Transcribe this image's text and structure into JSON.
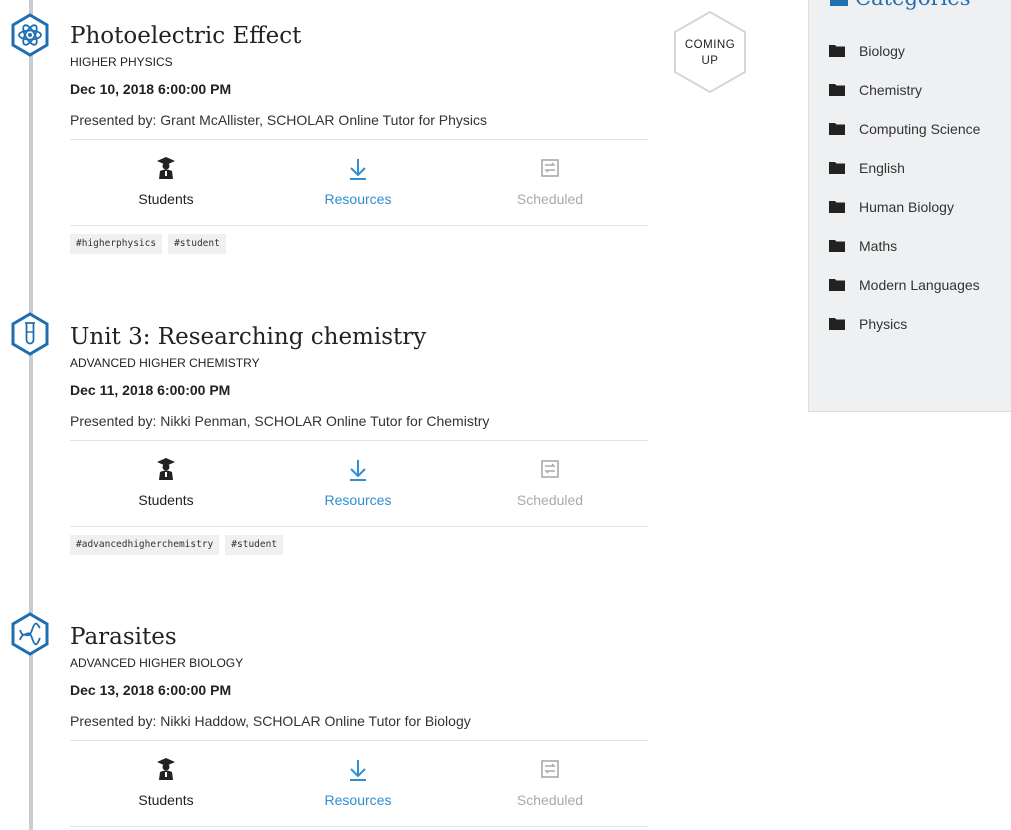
{
  "badge": {
    "line1": "COMING",
    "line2": "UP"
  },
  "categories": {
    "title": "Categories",
    "items": [
      {
        "label": "Biology"
      },
      {
        "label": "Chemistry"
      },
      {
        "label": "Computing Science"
      },
      {
        "label": "English"
      },
      {
        "label": "Human Biology"
      },
      {
        "label": "Maths"
      },
      {
        "label": "Modern Languages"
      },
      {
        "label": "Physics"
      }
    ]
  },
  "events": [
    {
      "icon": "atom-icon",
      "title": "Photoelectric Effect",
      "course": "HIGHER PHYSICS",
      "date": "Dec 10, 2018 6:00:00 PM",
      "presenter": "Presented by: Grant McAllister, SCHOLAR Online Tutor for Physics",
      "actions": {
        "students": "Students",
        "resources": "Resources",
        "scheduled": "Scheduled"
      },
      "tags": [
        "#higherphysics",
        "#student"
      ]
    },
    {
      "icon": "test-tube-icon",
      "title": "Unit 3: Researching chemistry",
      "course": "ADVANCED HIGHER CHEMISTRY",
      "date": "Dec 11, 2018 6:00:00 PM",
      "presenter": "Presented by: Nikki Penman, SCHOLAR Online Tutor for Chemistry",
      "actions": {
        "students": "Students",
        "resources": "Resources",
        "scheduled": "Scheduled"
      },
      "tags": [
        "#advancedhigherchemistry",
        "#student"
      ]
    },
    {
      "icon": "dna-icon",
      "title": "Parasites",
      "course": "ADVANCED HIGHER BIOLOGY",
      "date": "Dec 13, 2018 6:00:00 PM",
      "presenter": "Presented by: Nikki Haddow, SCHOLAR Online Tutor for Biology",
      "actions": {
        "students": "Students",
        "resources": "Resources",
        "scheduled": "Scheduled"
      },
      "tags": []
    }
  ],
  "colors": {
    "accent": "#1f6fb0",
    "link": "#2f8fd1",
    "muted": "#a9a9a9",
    "timeline": "#c9ccd0"
  }
}
